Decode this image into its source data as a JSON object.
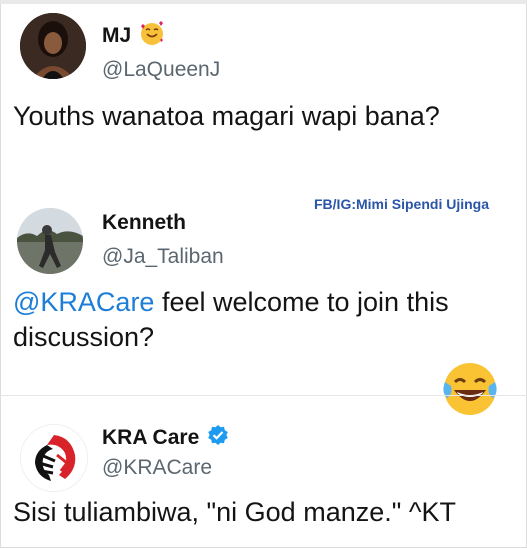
{
  "tweets": [
    {
      "name": "MJ",
      "name_emoji": "smiling-face-with-hearts-icon",
      "handle": "@LaQueenJ",
      "text": "Youths wanatoa magari wapi bana?"
    },
    {
      "name": "Kenneth",
      "handle": "@Ja_Taliban",
      "mention": "@KRACare",
      "text": " feel welcome to join this discussion?",
      "watermark": "FB/IG:Mimi Sipendi Ujinga"
    },
    {
      "name": "KRA Care",
      "verified": true,
      "handle": "@KRACare",
      "text": "Sisi tuliambiwa, \"ni God manze.\"   ^KT"
    }
  ],
  "reaction_emoji": "face-with-tears-of-joy-icon",
  "colors": {
    "link": "#1d7ed8",
    "handle": "#5b6770",
    "verified": "#1d9bf0",
    "watermark": "#2a55a8"
  }
}
